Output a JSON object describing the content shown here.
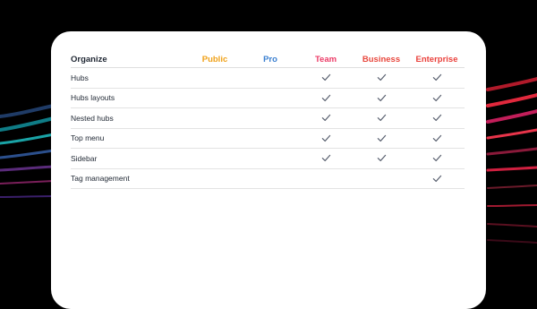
{
  "table": {
    "header": {
      "title": "Organize",
      "plans": [
        {
          "label": "Public",
          "color": "#f0a21a"
        },
        {
          "label": "Pro",
          "color": "#3a7fd0"
        },
        {
          "label": "Team",
          "color": "#ec3a66"
        },
        {
          "label": "Business",
          "color": "#e8473d"
        },
        {
          "label": "Enterprise",
          "color": "#ea3f3a"
        }
      ]
    },
    "rows": [
      {
        "feature": "Hubs",
        "included": [
          false,
          false,
          true,
          true,
          true
        ]
      },
      {
        "feature": "Hubs layouts",
        "included": [
          false,
          false,
          true,
          true,
          true
        ]
      },
      {
        "feature": "Nested hubs",
        "included": [
          false,
          false,
          true,
          true,
          true
        ]
      },
      {
        "feature": "Top menu",
        "included": [
          false,
          false,
          true,
          true,
          true
        ]
      },
      {
        "feature": "Sidebar",
        "included": [
          false,
          false,
          true,
          true,
          true
        ]
      },
      {
        "feature": "Tag management",
        "included": [
          false,
          false,
          false,
          false,
          true
        ]
      }
    ]
  },
  "colors": {
    "background": "#000000",
    "card": "#ffffff",
    "text": "#1f2733",
    "check": "#5a6170"
  },
  "icons": {
    "included": "checkmark-icon"
  }
}
